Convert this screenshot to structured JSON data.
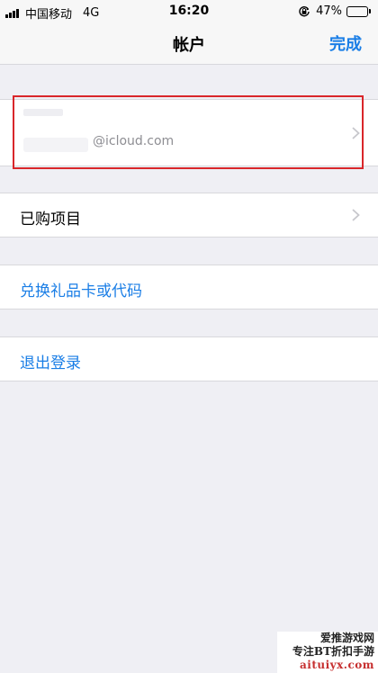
{
  "status_bar": {
    "carrier": "中国移动",
    "network": "4G",
    "time": "16:20",
    "battery": "47%",
    "battery_level": 0.47
  },
  "navbar": {
    "title": "帐户",
    "done_label": "完成"
  },
  "account": {
    "email": "@icloud.com",
    "highlight_color": "#d9262a"
  },
  "purchased": {
    "label": "已购项目"
  },
  "redeem": {
    "label": "兑换礼品卡或代码"
  },
  "signout": {
    "label": "退出登录"
  },
  "watermark": {
    "line1": "爱推游戏网",
    "line2": "专注BT折扣手游",
    "line3": "aituiyx.com"
  },
  "colors": {
    "link": "#1a7ee6",
    "background": "#efeff4"
  }
}
